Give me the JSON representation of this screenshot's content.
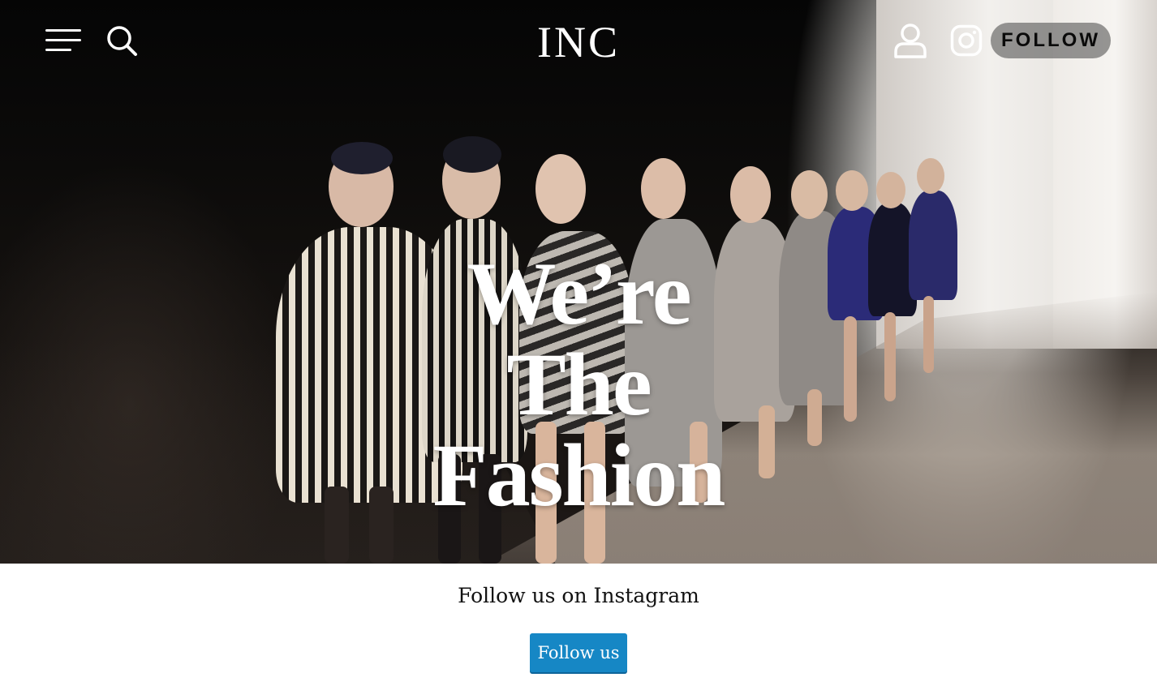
{
  "header": {
    "logo": "INC",
    "follow_label": "FOLLOW",
    "icons": [
      "menu-icon",
      "search-icon",
      "user-icon",
      "instagram-icon"
    ]
  },
  "hero": {
    "headline": [
      "We’re",
      "The",
      "Fashion"
    ]
  },
  "cta": {
    "text": "Follow us on Instagram",
    "button_label": "Follow us"
  },
  "colors": {
    "button": "#1687c5",
    "header_text": "#ffffff",
    "follow_pill": "rgba(70,70,70,0.55)"
  }
}
